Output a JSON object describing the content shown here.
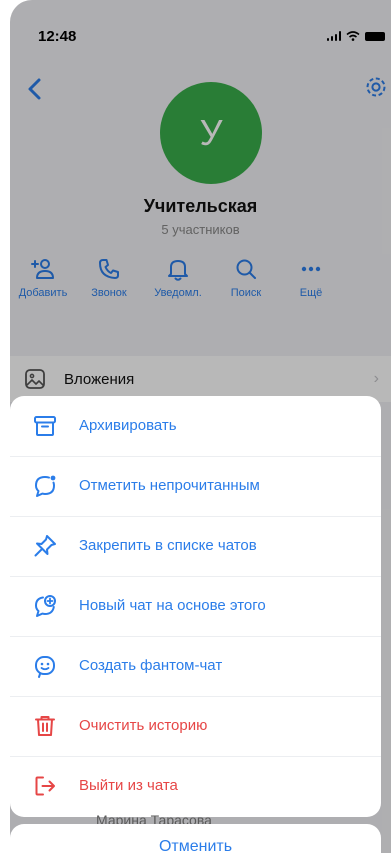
{
  "status_bar": {
    "time": "12:48"
  },
  "chat": {
    "avatar_letter": "У",
    "title": "Учительская",
    "subtitle": "5 участников",
    "avatar_color": "#3aad4b"
  },
  "actions": [
    {
      "label": "Добавить",
      "icon": "add-user-icon"
    },
    {
      "label": "Звонок",
      "icon": "phone-icon"
    },
    {
      "label": "Уведомл.",
      "icon": "bell-icon"
    },
    {
      "label": "Поиск",
      "icon": "search-icon"
    },
    {
      "label": "Ещё",
      "icon": "more-icon"
    }
  ],
  "attachments": {
    "label": "Вложения"
  },
  "sheet": {
    "items": [
      {
        "label": "Архивировать",
        "icon": "archive-icon",
        "danger": false
      },
      {
        "label": "Отметить непрочитанным",
        "icon": "mark-unread-icon",
        "danger": false
      },
      {
        "label": "Закрепить в списке чатов",
        "icon": "pin-icon",
        "danger": false
      },
      {
        "label": "Новый чат на основе этого",
        "icon": "new-chat-icon",
        "danger": false
      },
      {
        "label": "Создать фантом-чат",
        "icon": "phantom-chat-icon",
        "danger": false
      },
      {
        "label": "Очистить историю",
        "icon": "trash-icon",
        "danger": true
      },
      {
        "label": "Выйти из чата",
        "icon": "exit-icon",
        "danger": true
      }
    ],
    "peek_member": "Марина Тарасова",
    "cancel_label": "Отменить"
  },
  "colors": {
    "accent": "#2b7de9",
    "danger": "#e64646"
  }
}
